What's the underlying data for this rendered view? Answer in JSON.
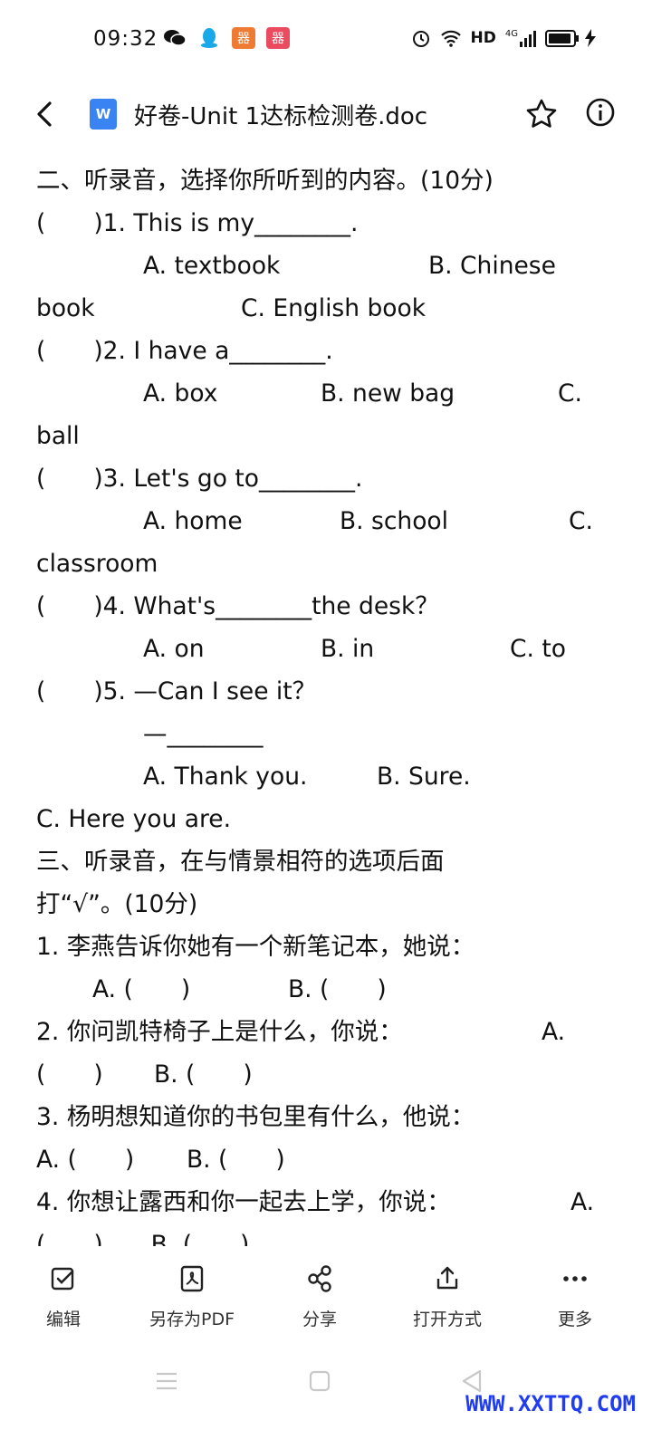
{
  "status_bar": {
    "time": "09:32",
    "network": "HD",
    "signal": "4G"
  },
  "header": {
    "title": "好卷-Unit 1达标检测卷.doc",
    "doc_icon_letter": "W"
  },
  "document": {
    "lines": {
      "s2": "二、听录音，选择你所听到的内容。(10分)",
      "q1": "(　　)1. This is my________.",
      "q1a": "A. textbook",
      "q1b": "B. Chinese",
      "q1c_cont": "book",
      "q1c": "C. English book",
      "q2": "(　　)2. I have a________.",
      "q2a": "A. box",
      "q2b": "B. new bag",
      "q2c": "C.",
      "q2c_cont": "ball",
      "q3": "(　　)3. Let's go to________.",
      "q3a": "A. home",
      "q3b": "B. school",
      "q3c": "C.",
      "q3c_cont": "classroom",
      "q4": "(　　)4. What's________the desk？",
      "q4a": "A. on",
      "q4b": "B. in",
      "q4c": "C. to",
      "q5": "(　　)5. —Can I see it？",
      "q5_reply": "—________",
      "q5a": "A. Thank you.",
      "q5b": "B. Sure.",
      "q5c": "C. Here you are.",
      "s3_line1": "三、听录音，在与情景相符的选项后面",
      "s3_line2": "打“√”。(10分)",
      "p1": "1. 李燕告诉你她有一个新笔记本，她说：",
      "p1a": "A. (　　)",
      "p1b": "B. (　　)",
      "p2": "2. 你问凯特椅子上是什么，你说：",
      "p2a": "A.",
      "p2a_cont": "(　　)",
      "p2b": "B. (　　)",
      "p3": "3. 杨明想知道你的书包里有什么，他说：",
      "p3a": "A. (　　)",
      "p3b": "B. (　　)",
      "p4": "4. 你想让露西和你一起去上学，你说：",
      "p4a": "A.",
      "p4_partial": "(　　)　　B. (　　)"
    }
  },
  "toolbar": {
    "items": [
      {
        "label": "编辑",
        "icon": "edit-icon"
      },
      {
        "label": "另存为PDF",
        "icon": "pdf-icon"
      },
      {
        "label": "分享",
        "icon": "share-icon"
      },
      {
        "label": "打开方式",
        "icon": "open-with-icon"
      },
      {
        "label": "更多",
        "icon": "more-icon"
      }
    ]
  },
  "watermark": "WWW.XXTTQ.COM"
}
